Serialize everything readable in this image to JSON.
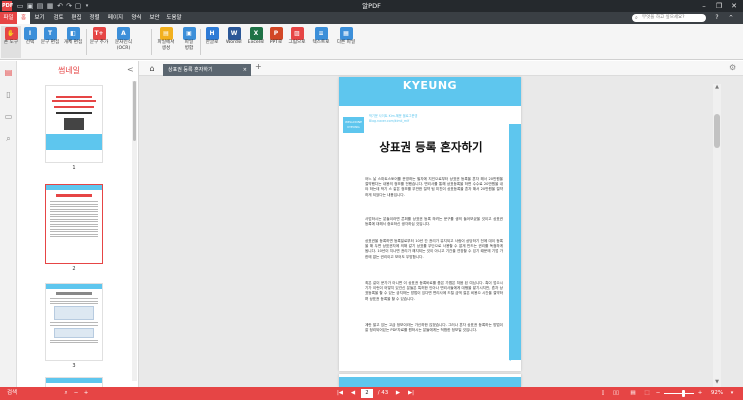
{
  "window": {
    "title": "알PDF",
    "app_icon": "PDF",
    "quick_access": [
      "folder-icon",
      "save-icon",
      "print-icon",
      "save-as-icon",
      "undo-icon",
      "redo-icon",
      "copy-icon",
      "qa-dropdown-icon"
    ],
    "controls": [
      "minimize-icon",
      "maximize-icon",
      "close-icon"
    ]
  },
  "menubar": {
    "items": [
      {
        "label": "파일",
        "state": "active"
      },
      {
        "label": "홈",
        "state": "selected"
      },
      {
        "label": "보기",
        "state": "normal"
      },
      {
        "label": "검토",
        "state": "normal"
      },
      {
        "label": "편집",
        "state": "normal"
      },
      {
        "label": "정렬",
        "state": "normal"
      },
      {
        "label": "페이지",
        "state": "normal"
      },
      {
        "label": "양식",
        "state": "normal"
      },
      {
        "label": "보안",
        "state": "normal"
      },
      {
        "label": "도움말",
        "state": "normal"
      }
    ],
    "search_placeholder": "무엇을 하고 싶으세요?",
    "help_icon": "?",
    "collapse_icon": "^"
  },
  "ribbon": {
    "buttons": [
      {
        "label": "손 도구",
        "icon": "hand-icon",
        "glyph": "✋",
        "color": "#e64545",
        "active": true
      },
      {
        "label": "선택",
        "icon": "select-icon",
        "glyph": "Ⅰ",
        "color": "#3c8fd9",
        "active": false
      },
      {
        "label": "문구 편집",
        "icon": "edit-text-icon",
        "glyph": "T",
        "color": "#3c8fd9",
        "active": false
      },
      {
        "label": "개체 편집",
        "icon": "edit-object-icon",
        "glyph": "◧",
        "color": "#3c8fd9",
        "active": false
      },
      {
        "label": "문구 추가",
        "icon": "add-text-icon",
        "glyph": "T+",
        "color": "#e64545",
        "active": false
      },
      {
        "label": "문자인식 (OCR)",
        "icon": "ocr-icon",
        "glyph": "A",
        "color": "#3c8fd9",
        "active": false
      },
      {
        "label": "파일에서 생성",
        "icon": "create-from-file-icon",
        "glyph": "▤",
        "color": "#f2b01e",
        "active": false
      },
      {
        "label": "파일 병합",
        "icon": "merge-icon",
        "glyph": "▣",
        "color": "#3c8fd9",
        "active": false
      },
      {
        "label": "한글로",
        "icon": "to-hwp-icon",
        "glyph": "H",
        "color": "#2e7bd6",
        "active": false
      },
      {
        "label": "Word로",
        "icon": "to-word-icon",
        "glyph": "W",
        "color": "#2b5797",
        "active": false
      },
      {
        "label": "Excel로",
        "icon": "to-excel-icon",
        "glyph": "X",
        "color": "#1f7246",
        "active": false
      },
      {
        "label": "PPT로",
        "icon": "to-ppt-icon",
        "glyph": "P",
        "color": "#d24726",
        "active": false
      },
      {
        "label": "그림으로",
        "icon": "to-image-icon",
        "glyph": "▨",
        "color": "#e64545",
        "active": false
      },
      {
        "label": "텍스트로",
        "icon": "to-text-icon",
        "glyph": "≡",
        "color": "#3c8fd9",
        "active": false
      },
      {
        "label": "다른 파일",
        "icon": "other-file-icon",
        "glyph": "▦",
        "color": "#3c8fd9",
        "active": false
      }
    ]
  },
  "left_tools": [
    "thumbnail-panel-icon",
    "bookmark-panel-icon",
    "comment-panel-icon",
    "search-panel-icon"
  ],
  "thumbnails": {
    "title": "썸네일",
    "close_glyph": "<",
    "pages": [
      {
        "number": "1",
        "selected": false
      },
      {
        "number": "2",
        "selected": true
      },
      {
        "number": "3",
        "selected": false
      }
    ]
  },
  "tabs": {
    "home_glyph": "⌂",
    "active_tab": "상표권 등록 혼자하기",
    "close_glyph": "×",
    "new_tab_glyph": "+",
    "settings_glyph": "⚙"
  },
  "document": {
    "brand": "KYEUNG",
    "logo_text": "WELLDONE KYEUNG",
    "meta_line1": "박기운 사이트 Kim-혜운 블로그운영",
    "meta_line2": "Blog.naver.com/kimii_mlf",
    "title": "상표권 등록 혼자하기",
    "paragraphs": [
      "어느 날 스마트스토어를 운영하는 필자에 지인으로부터 상표권 등록을 혼자 해서 20만원을 절약했다는 내용의 정보를 전했습니다. 변리사를 통해 상표등록을 하면 수수료 20만원을 내야 하는데 박기 스 같은 정보를 무반한 절약 팀 미친이 상표등록을 혼자 해서 20만원을 절약하게 되었다는 내용입니다.",
      "사업하시는 분들이라면 콘퍼를 상표권 등록 하려는 문구를 생의 들어보셨을 것이고 상표권 등록에 대해서 중요하신 생각하십 것입니다.",
      "상표권을 등록하면 등록일로부터 10년 간 권리가 유지되고 사람이 상당하기 전에 대이 등록을 해 두면 상표권자에 의해 갈기 상표를 무단으로 사용할 수 없게 만드는 권리를 독점하게 됩니다. 10년이 지나면 권리가 해지되는 것이 아니고 기간을 연장할 수 있기 때문에 기업 가한에 없는 권리이고 보어도 무방합니다.",
      "최은 같이 문가가 아니면 이 상표권 등록바로를 좀은 가볍은 처음 된 여닙니다. 혹이 업으시기가 이런이 어떻지 있건신 분들은 특허한 인아나 변리사들에게 대행을 맡기시지만, 혼자 상표등록을 할 수 있는 궁지하는 방법이 있다면 변리사에 드릴 금액 절은 비용으 시간을 절약하며 상표권 등록을 할 수 있습니다.",
      "계란 발고 있는 고급 정보이라는 가신하한 않겠습니다. 그러나 혼자 상표권 등록하는 방법이 잘 정리되어있는 PDF자료를 원하시는 분들에게는 적합한 정보일 것입니다."
    ],
    "page_number": "1"
  },
  "statusbar": {
    "left_label": "검색",
    "zoom_out_glyph": "−",
    "zoom_in_glyph": "+",
    "first_glyph": "|◀",
    "prev_glyph": "◀",
    "current_page": "2",
    "total_pages": "/ 43",
    "next_glyph": "▶",
    "last_glyph": "▶|",
    "zoom_value": "92%",
    "view_modes": [
      "single-page-icon",
      "two-page-icon",
      "continuous-icon",
      "fit-icon"
    ]
  }
}
